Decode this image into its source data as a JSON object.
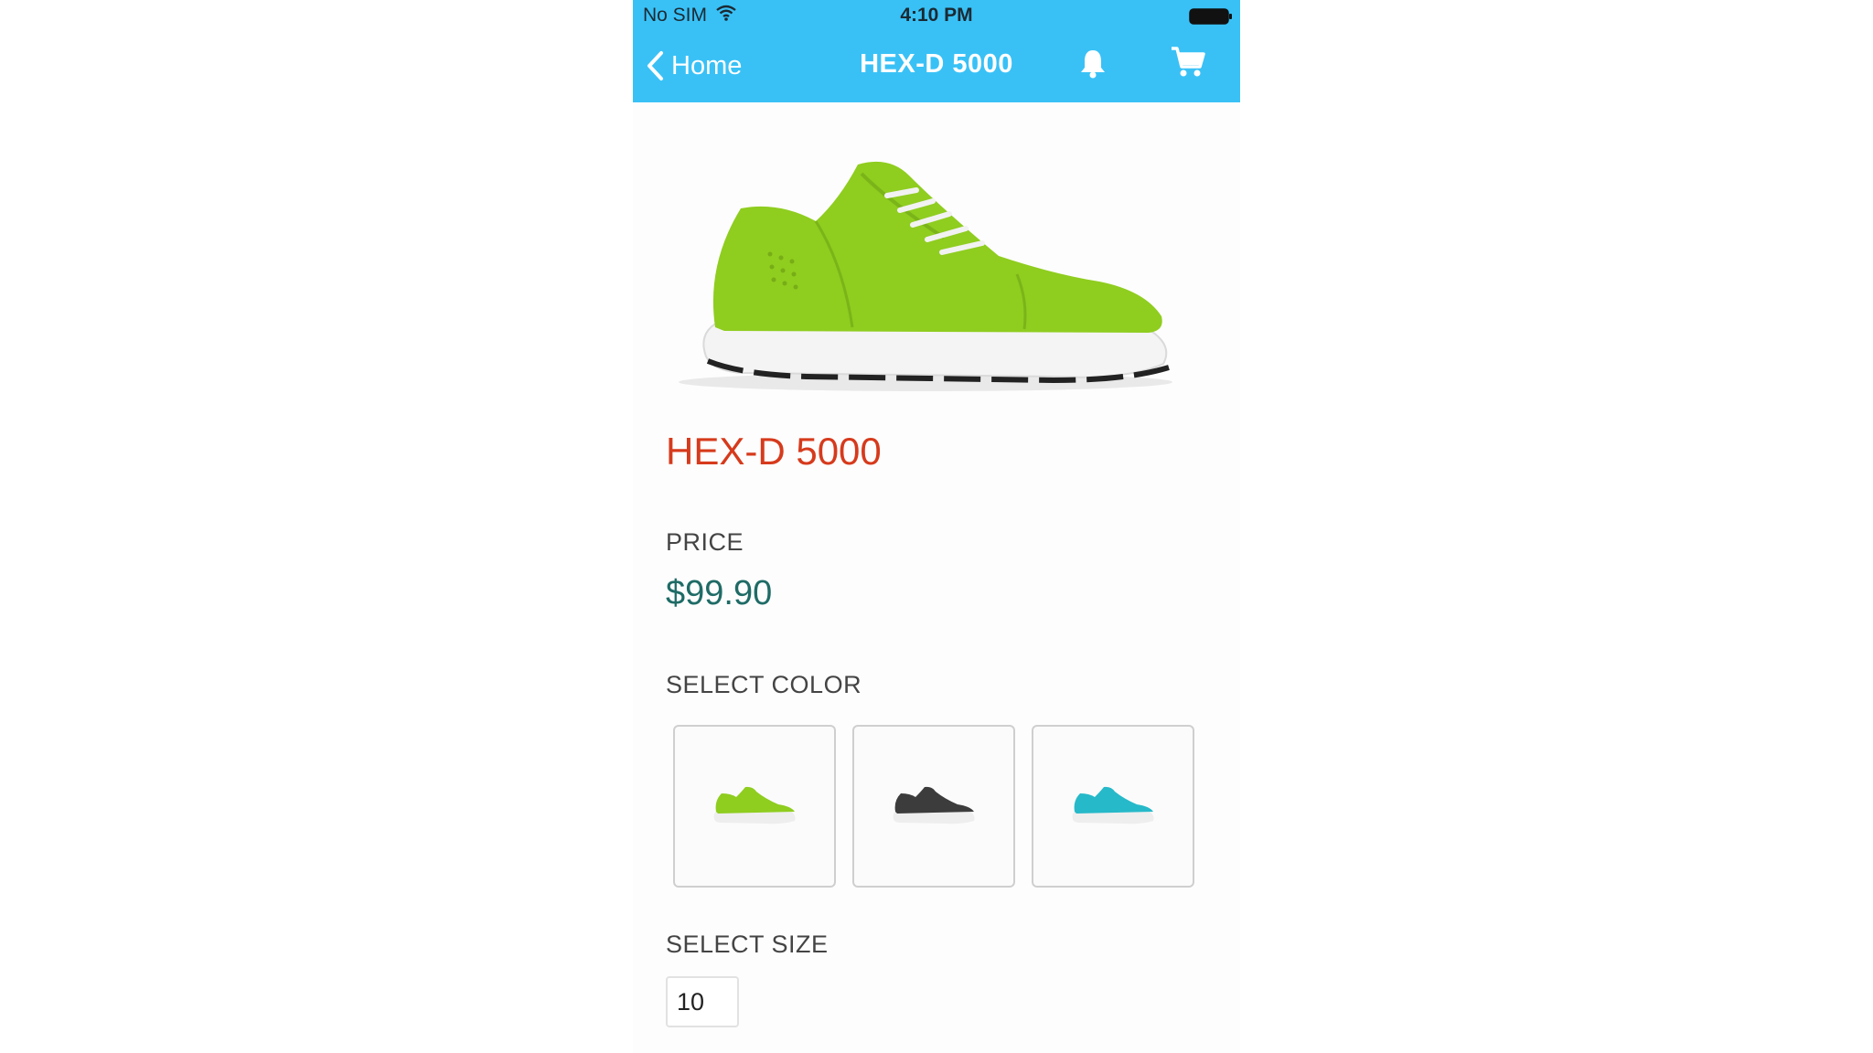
{
  "status_bar": {
    "carrier": "No SIM",
    "time": "4:10 PM"
  },
  "nav": {
    "back_label": "Home",
    "title": "HEX-D 5000"
  },
  "product": {
    "name": "HEX-D 5000",
    "price_label": "PRICE",
    "price": "$99.90"
  },
  "colors": {
    "label": "SELECT COLOR",
    "options": [
      {
        "name": "lime-green",
        "hex": "#8fcd1f"
      },
      {
        "name": "charcoal",
        "hex": "#3c3c3c"
      },
      {
        "name": "turquoise",
        "hex": "#26b9c9"
      }
    ]
  },
  "size": {
    "label": "SELECT SIZE",
    "value": "10"
  },
  "theme": {
    "header_bg": "#39c1f6",
    "name_color": "#d63a1c",
    "price_color": "#1f6b66"
  }
}
